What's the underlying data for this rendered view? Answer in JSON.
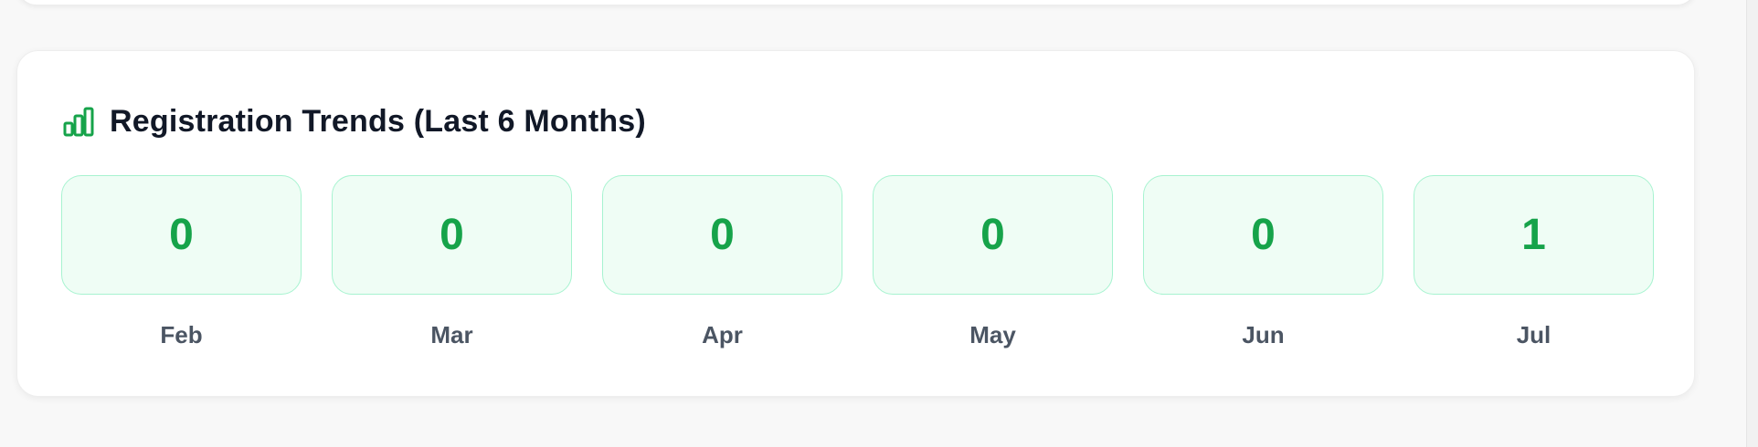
{
  "trends": {
    "title": "Registration Trends (Last 6 Months)",
    "icon": "bar-chart-icon",
    "accent_color": "#16a34a",
    "months": [
      {
        "label": "Feb",
        "value": "0"
      },
      {
        "label": "Mar",
        "value": "0"
      },
      {
        "label": "Apr",
        "value": "0"
      },
      {
        "label": "May",
        "value": "0"
      },
      {
        "label": "Jun",
        "value": "0"
      },
      {
        "label": "Jul",
        "value": "1"
      }
    ]
  }
}
